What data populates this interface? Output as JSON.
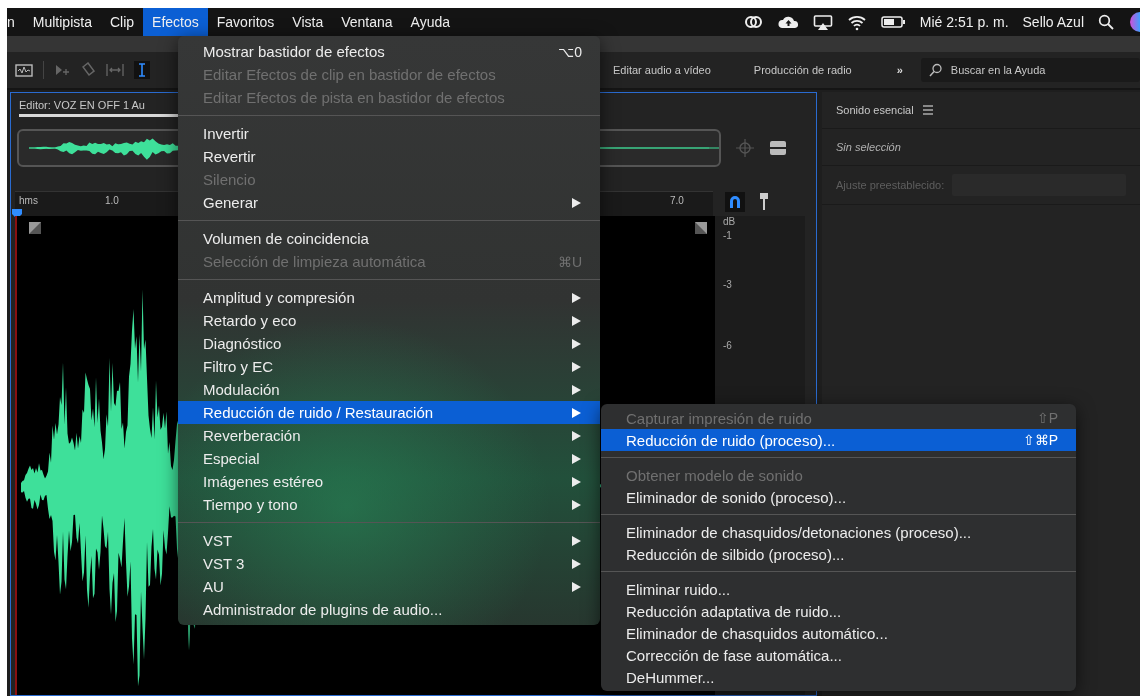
{
  "menu_bar": {
    "items": [
      {
        "label": "n",
        "selected": false
      },
      {
        "label": "Multipista",
        "selected": false
      },
      {
        "label": "Clip",
        "selected": false
      },
      {
        "label": "Efectos",
        "selected": true
      },
      {
        "label": "Favoritos",
        "selected": false
      },
      {
        "label": "Vista",
        "selected": false
      },
      {
        "label": "Ventana",
        "selected": false
      },
      {
        "label": "Ayuda",
        "selected": false
      }
    ],
    "clock": "Mié 2:51 p. m.",
    "user": "Sello Azul"
  },
  "toolbar": {
    "workspaces": [
      "Editar audio a vídeo",
      "Producción de radio"
    ],
    "more": "»",
    "search": {
      "placeholder": "Buscar en la Ayuda"
    }
  },
  "editor": {
    "title": "Editor: VOZ EN OFF 1 Au",
    "ruler": {
      "unit": "hms",
      "ticks": [
        "1.0",
        "7.0"
      ]
    },
    "db_scale": {
      "unit": "dB",
      "ticks": [
        "-1",
        "-3",
        "-6"
      ]
    }
  },
  "essential_sound": {
    "title": "Sonido esencial",
    "status": "Sin selección",
    "preset_label": "Ajuste preestablecido:"
  },
  "effects_menu": {
    "groups": [
      {
        "items": [
          {
            "label": "Mostrar bastidor de efectos",
            "shortcut": "⌥0",
            "disabled": false,
            "submenu": false,
            "selected": false
          },
          {
            "label": "Editar Efectos de clip en bastidor de efectos",
            "disabled": true,
            "submenu": false,
            "selected": false
          },
          {
            "label": "Editar Efectos de pista en bastidor de efectos",
            "disabled": true,
            "submenu": false,
            "selected": false
          }
        ]
      },
      {
        "items": [
          {
            "label": "Invertir",
            "disabled": false,
            "submenu": false,
            "selected": false
          },
          {
            "label": "Revertir",
            "disabled": false,
            "submenu": false,
            "selected": false
          },
          {
            "label": "Silencio",
            "disabled": true,
            "submenu": false,
            "selected": false
          },
          {
            "label": "Generar",
            "disabled": false,
            "submenu": true,
            "selected": false
          }
        ]
      },
      {
        "items": [
          {
            "label": "Volumen de coincidencia",
            "disabled": false,
            "submenu": false,
            "selected": false
          },
          {
            "label": "Selección de limpieza automática",
            "shortcut": "⌘U",
            "disabled": true,
            "submenu": false,
            "selected": false
          }
        ]
      },
      {
        "items": [
          {
            "label": "Amplitud y compresión",
            "disabled": false,
            "submenu": true,
            "selected": false
          },
          {
            "label": "Retardo y eco",
            "disabled": false,
            "submenu": true,
            "selected": false
          },
          {
            "label": "Diagnóstico",
            "disabled": false,
            "submenu": true,
            "selected": false
          },
          {
            "label": "Filtro y EC",
            "disabled": false,
            "submenu": true,
            "selected": false
          },
          {
            "label": "Modulación",
            "disabled": false,
            "submenu": true,
            "selected": false
          },
          {
            "label": "Reducción de ruido / Restauración",
            "disabled": false,
            "submenu": true,
            "selected": true
          },
          {
            "label": "Reverberación",
            "disabled": false,
            "submenu": true,
            "selected": false
          },
          {
            "label": "Especial",
            "disabled": false,
            "submenu": true,
            "selected": false
          },
          {
            "label": "Imágenes estéreo",
            "disabled": false,
            "submenu": true,
            "selected": false
          },
          {
            "label": "Tiempo y tono",
            "disabled": false,
            "submenu": true,
            "selected": false
          }
        ]
      },
      {
        "items": [
          {
            "label": "VST",
            "disabled": false,
            "submenu": true,
            "selected": false
          },
          {
            "label": "VST 3",
            "disabled": false,
            "submenu": true,
            "selected": false
          },
          {
            "label": "AU",
            "disabled": false,
            "submenu": true,
            "selected": false
          },
          {
            "label": "Administrador de plugins de audio...",
            "disabled": false,
            "submenu": false,
            "selected": false
          }
        ]
      }
    ]
  },
  "noise_submenu": {
    "groups": [
      {
        "items": [
          {
            "label": "Capturar impresión de ruido",
            "shortcut": "⇧P",
            "disabled": true,
            "submenu": false,
            "selected": false
          },
          {
            "label": "Reducción de ruido (proceso)...",
            "shortcut": "⇧⌘P",
            "disabled": false,
            "submenu": false,
            "selected": true
          }
        ]
      },
      {
        "items": [
          {
            "label": "Obtener modelo de sonido",
            "disabled": true,
            "submenu": false,
            "selected": false
          },
          {
            "label": "Eliminador de sonido (proceso)...",
            "disabled": false,
            "submenu": false,
            "selected": false
          }
        ]
      },
      {
        "items": [
          {
            "label": "Eliminador de chasquidos/detonaciones (proceso)...",
            "disabled": false,
            "submenu": false,
            "selected": false
          },
          {
            "label": "Reducción de silbido (proceso)...",
            "disabled": false,
            "submenu": false,
            "selected": false
          }
        ]
      },
      {
        "items": [
          {
            "label": "Eliminar ruido...",
            "disabled": false,
            "submenu": false,
            "selected": false
          },
          {
            "label": "Reducción adaptativa de ruido...",
            "disabled": false,
            "submenu": false,
            "selected": false
          },
          {
            "label": "Eliminador de chasquidos automático...",
            "disabled": false,
            "submenu": false,
            "selected": false
          },
          {
            "label": "Corrección de fase automática...",
            "disabled": false,
            "submenu": false,
            "selected": false
          },
          {
            "label": "DeHummer...",
            "disabled": false,
            "submenu": false,
            "selected": false
          }
        ]
      }
    ]
  }
}
